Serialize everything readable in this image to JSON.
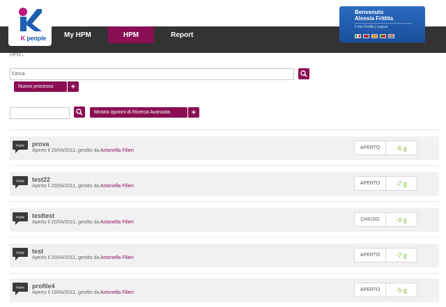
{
  "logo": {
    "text_k": "K",
    "text_people": "people"
  },
  "nav": {
    "items": [
      "My HPM",
      "HPM",
      "Report"
    ],
    "active_index": 1
  },
  "user": {
    "welcome": "Benvenuto",
    "name": "Alessia Frittita",
    "links": "Il mio Profilo | Logout",
    "flags": [
      "it-flag-icon",
      "uk-flag-icon",
      "es-flag-icon",
      "pt-flag-icon",
      "nl-flag-icon"
    ]
  },
  "breadcrumb": {
    "text": "HPM",
    "separator": "▸"
  },
  "search": {
    "value": "Cerca",
    "new_process_label": "Nuovo processo",
    "advanced_label": "Mostra opzioni di Ricerca Avanzata",
    "plus": "+"
  },
  "colors": {
    "accent": "#8a0f52",
    "header_bg": "#333333",
    "user_panel": "#2a6bc2",
    "days": "#7fb83a"
  },
  "processes": [
    {
      "badge": "Public",
      "title": "prova",
      "opened_text": "Aperto il 20/04/2011, gestito da",
      "manager": "Antonella Filieri",
      "status": "APERTO",
      "days": "-6 g"
    },
    {
      "badge": "Public",
      "title": "test22",
      "opened_text": "Aperto il 20/04/2011, gestito da",
      "manager": "Antonella Filieri",
      "status": "APERTO",
      "days": "-7 g"
    },
    {
      "badge": "Public",
      "title": "testtest",
      "opened_text": "Aperto il 20/04/2011, gestito da",
      "manager": "Antonella Filieri",
      "status": "CHIUSO",
      "days": "-9 g"
    },
    {
      "badge": "Public",
      "title": "test",
      "opened_text": "Aperto il 20/04/2011, gestito da",
      "manager": "Antonella Filieri",
      "status": "APERTO",
      "days": "-7 g"
    },
    {
      "badge": "Public",
      "title": "profile4",
      "opened_text": "Aperto il 19/04/2011, gestito da",
      "manager": "Antonella Filieri",
      "status": "APERTO",
      "days": "-5 g"
    }
  ]
}
